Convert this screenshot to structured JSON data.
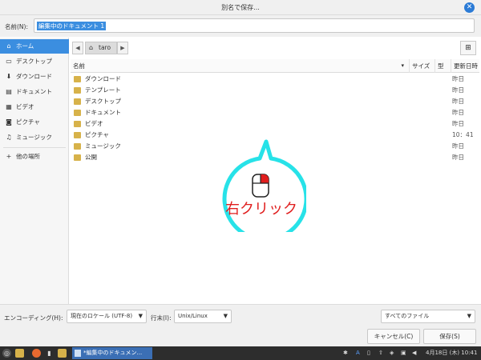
{
  "window": {
    "title": "別名で保存...",
    "close_glyph": "✕"
  },
  "name_field": {
    "label": "名前(N):",
    "value": "編集中のドキュメント 1"
  },
  "sidebar": {
    "items": [
      {
        "label": "ホーム",
        "icon": "home-icon",
        "glyph": "⌂",
        "active": true
      },
      {
        "label": "デスクトップ",
        "icon": "desktop-icon",
        "glyph": "▭"
      },
      {
        "label": "ダウンロード",
        "icon": "download-icon",
        "glyph": "⬇"
      },
      {
        "label": "ドキュメント",
        "icon": "document-icon",
        "glyph": "▤"
      },
      {
        "label": "ビデオ",
        "icon": "video-icon",
        "glyph": "▦"
      },
      {
        "label": "ピクチャ",
        "icon": "camera-icon",
        "glyph": "◙"
      },
      {
        "label": "ミュージック",
        "icon": "music-icon",
        "glyph": "♫"
      },
      {
        "label": "他の場所",
        "icon": "plus-icon",
        "glyph": "+"
      }
    ]
  },
  "pathbar": {
    "back": "◀",
    "forward": "▶",
    "crumb": "taro",
    "new_folder_glyph": "⊞"
  },
  "columns": {
    "name": "名前",
    "size": "サイズ",
    "type": "型",
    "modified": "更新日時"
  },
  "files": [
    {
      "name": "ダウンロード",
      "modified": "昨日"
    },
    {
      "name": "テンプレート",
      "modified": "昨日"
    },
    {
      "name": "デスクトップ",
      "modified": "昨日"
    },
    {
      "name": "ドキュメント",
      "modified": "昨日"
    },
    {
      "name": "ビデオ",
      "modified": "昨日"
    },
    {
      "name": "ピクチャ",
      "modified": "10：41"
    },
    {
      "name": "ミュージック",
      "modified": "昨日"
    },
    {
      "name": "公開",
      "modified": "昨日"
    }
  ],
  "overlay": {
    "text": "右クリック",
    "ring_color": "#27e2e8",
    "text_color": "#e01e1e"
  },
  "bottom": {
    "encoding_label": "エンコーディング(H):",
    "encoding_value": "現在のロケール (UTF-8)",
    "lineend_label": "行末(I):",
    "lineend_value": "Unix/Linux",
    "filter_value": "すべてのファイル",
    "cancel": "キャンセル(C)",
    "save": "保存(S)"
  },
  "taskbar": {
    "task_label": "*編集中のドキュメン...",
    "date": "4月18日 (木) 10:41",
    "lang": "A"
  },
  "colors": {
    "accent": "#3b8ee0",
    "folder": "#d7b24a"
  }
}
